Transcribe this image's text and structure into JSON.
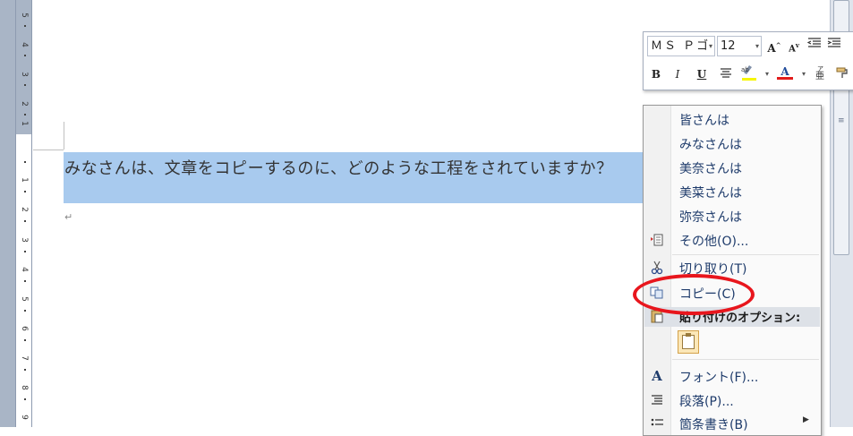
{
  "document": {
    "selected_text": "みなさんは、文章をコピーするのに、どのような工程をされていますか？",
    "paragraph_mark": "↵"
  },
  "ruler": {
    "numbers": [
      "1",
      "2",
      "3",
      "4",
      "5",
      "6",
      "7",
      "8",
      "9"
    ],
    "top_numbers": [
      "5",
      "4",
      "3",
      "2",
      "1"
    ]
  },
  "mini_toolbar": {
    "font_name": "ＭＳ Ｐゴ",
    "font_size": "12",
    "grow_font": "A",
    "shrink_font": "A",
    "bold": "B",
    "italic": "I",
    "underline": "U",
    "font_color_letter": "A",
    "highlight_color": "#f6f600",
    "font_color": "#e21b1b"
  },
  "context_menu": {
    "items": [
      {
        "label": "皆さんは"
      },
      {
        "label": "みなさんは"
      },
      {
        "label": "美奈さんは"
      },
      {
        "label": "美菜さんは"
      },
      {
        "label": "弥奈さんは"
      },
      {
        "label": "その他(O)..."
      },
      {
        "label": "切り取り(T)"
      },
      {
        "label": "コピー(C)"
      },
      {
        "label": "貼り付けのオプション:"
      },
      {
        "label": "フォント(F)..."
      },
      {
        "label": "段落(P)..."
      },
      {
        "label": "箇条書き(B)"
      }
    ]
  },
  "annotation": {
    "color": "#e8161d"
  }
}
